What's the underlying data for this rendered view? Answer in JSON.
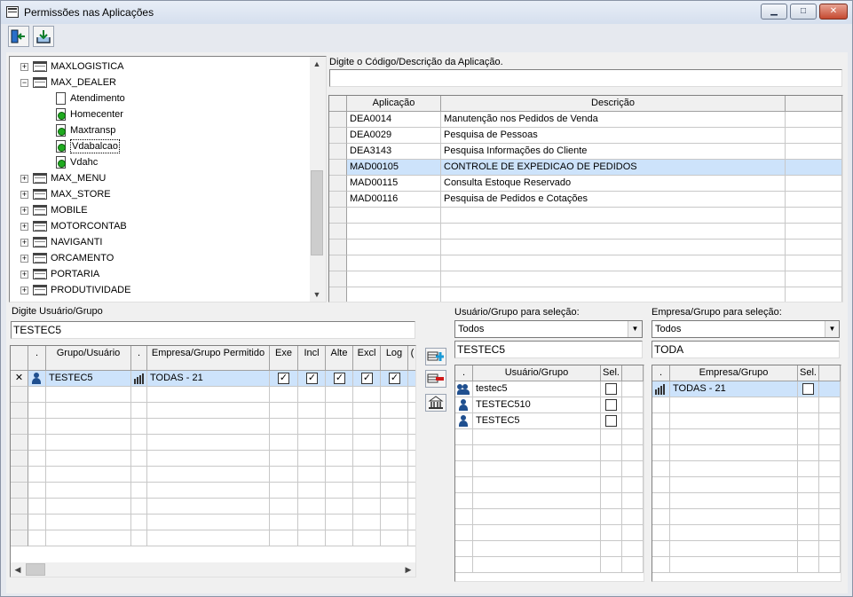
{
  "window": {
    "title": "Permissões nas Aplicações",
    "minimize_glyph": "▁",
    "maximize_glyph": "□",
    "close_glyph": "✕"
  },
  "toolbar": {
    "exit_icon": "exit-icon",
    "save_icon": "save-icon"
  },
  "tree": {
    "items": [
      {
        "label": "MAXLOGISTICA",
        "level": 0,
        "expander": "+",
        "icon": "folder"
      },
      {
        "label": "MAX_DEALER",
        "level": 0,
        "expander": "−",
        "icon": "folder"
      },
      {
        "label": "Atendimento",
        "level": 1,
        "expander": "",
        "icon": "doc"
      },
      {
        "label": "Homecenter",
        "level": 1,
        "expander": "",
        "icon": "app"
      },
      {
        "label": "Maxtransp",
        "level": 1,
        "expander": "",
        "icon": "app"
      },
      {
        "label": "Vdabalcao",
        "level": 1,
        "expander": "",
        "icon": "app",
        "selected": true
      },
      {
        "label": "Vdahc",
        "level": 1,
        "expander": "",
        "icon": "app"
      },
      {
        "label": "MAX_MENU",
        "level": 0,
        "expander": "+",
        "icon": "folder"
      },
      {
        "label": "MAX_STORE",
        "level": 0,
        "expander": "+",
        "icon": "folder"
      },
      {
        "label": "MOBILE",
        "level": 0,
        "expander": "+",
        "icon": "folder"
      },
      {
        "label": "MOTORCONTAB",
        "level": 0,
        "expander": "+",
        "icon": "folder"
      },
      {
        "label": "NAVIGANTI",
        "level": 0,
        "expander": "+",
        "icon": "folder"
      },
      {
        "label": "ORCAMENTO",
        "level": 0,
        "expander": "+",
        "icon": "folder"
      },
      {
        "label": "PORTARIA",
        "level": 0,
        "expander": "+",
        "icon": "folder"
      },
      {
        "label": "PRODUTIVIDADE",
        "level": 0,
        "expander": "+",
        "icon": "folder"
      }
    ]
  },
  "app_search": {
    "label": "Digite o Código/Descrição da Aplicação.",
    "value": ""
  },
  "app_grid": {
    "headers": [
      "Aplicação",
      "Descrição"
    ],
    "rows": [
      {
        "code": "DEA0014",
        "desc": "Manutenção nos Pedidos de Venda"
      },
      {
        "code": "DEA0029",
        "desc": "Pesquisa de Pessoas"
      },
      {
        "code": "DEA3143",
        "desc": "Pesquisa Informações do Cliente"
      },
      {
        "code": "MAD00105",
        "desc": "CONTROLE DE EXPEDICAO DE PEDIDOS",
        "selected": true
      },
      {
        "code": "MAD00115",
        "desc": "Consulta Estoque Reservado"
      },
      {
        "code": "MAD00116",
        "desc": "Pesquisa de Pedidos e Cotações"
      }
    ],
    "empty_rows": 6
  },
  "user_search": {
    "label": "Digite Usuário/Grupo",
    "value": "TESTEC5"
  },
  "perm_grid": {
    "headers": [
      ".",
      "Grupo/Usuário",
      ".",
      "Empresa/Grupo Permitido",
      "Exe",
      "Incl",
      "Alte",
      "Excl",
      "Log",
      "("
    ],
    "rows": [
      {
        "indicator": "✕",
        "user": "TESTEC5",
        "empresa": "TODAS - 21",
        "exe": true,
        "incl": true,
        "alte": true,
        "excl": true,
        "log": true
      }
    ],
    "empty_rows": 10
  },
  "side_buttons": {
    "add_icon": "add-permission-icon",
    "remove_icon": "remove-permission-icon",
    "bank_icon": "company-icon"
  },
  "user_select": {
    "label": "Usuário/Grupo para seleção:",
    "filter": "Todos",
    "value": "TESTEC5",
    "headers": [
      ".",
      "Usuário/Grupo",
      "Sel."
    ],
    "rows": [
      {
        "type": "group",
        "name": "testec5",
        "sel": false
      },
      {
        "type": "user",
        "name": "TESTEC510",
        "sel": false
      },
      {
        "type": "user",
        "name": "TESTEC5",
        "sel": false
      }
    ],
    "empty_rows": 9
  },
  "empresa_select": {
    "label": "Empresa/Grupo para seleção:",
    "filter": "Todos",
    "value": "TODA",
    "headers": [
      ".",
      "Empresa/Grupo",
      "Sel."
    ],
    "rows": [
      {
        "type": "company",
        "name": "TODAS - 21",
        "sel": false,
        "selected": true
      }
    ],
    "empty_rows": 11
  },
  "colors": {
    "selection": "#cde3fb",
    "accent": "#1f4f8f",
    "active_app": "#1faa1f"
  }
}
